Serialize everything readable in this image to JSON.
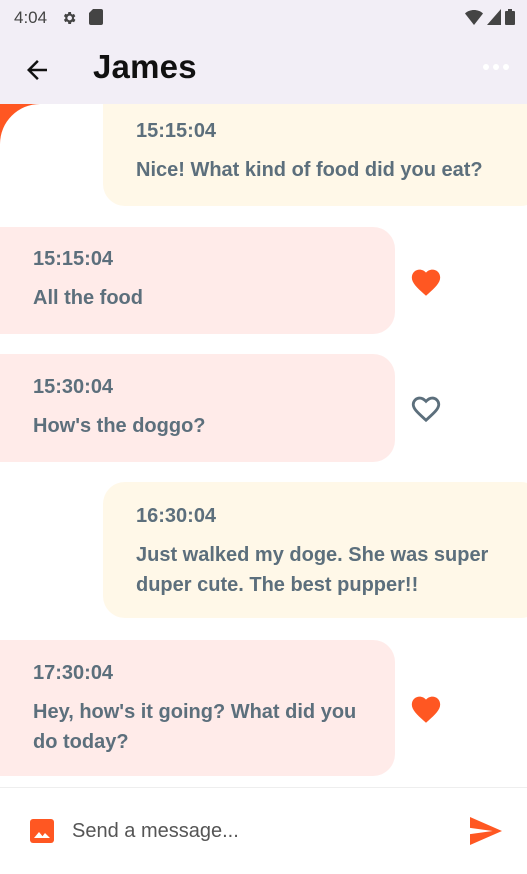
{
  "status_bar": {
    "time": "4:04"
  },
  "header": {
    "title": "James"
  },
  "messages": [
    {
      "direction": "sent",
      "time": "15:15:04",
      "text": "Nice! What kind of food did you eat?"
    },
    {
      "direction": "received",
      "time": "15:15:04",
      "text": "All the food",
      "liked": true
    },
    {
      "direction": "received",
      "time": "15:30:04",
      "text": "How's the doggo?",
      "liked": false
    },
    {
      "direction": "sent",
      "time": "16:30:04",
      "text": "Just walked my doge. She was super duper cute. The best pupper!!"
    },
    {
      "direction": "received",
      "time": "17:30:04",
      "text": "Hey, how's it going? What did you do today?",
      "liked": true
    }
  ],
  "composer": {
    "placeholder": "Send a message..."
  },
  "icons": {
    "back": "arrow-left-icon",
    "more": "more-horizontal-icon",
    "heart_filled": "heart-filled-icon",
    "heart_outline": "heart-outline-icon",
    "image": "image-icon",
    "send": "send-icon"
  },
  "colors": {
    "accent": "#ff5722",
    "app_bar_bg": "#f2eef6",
    "sent_bubble": "#fff8e8",
    "received_bubble": "#ffebe9",
    "message_text": "#5c6f7c"
  }
}
